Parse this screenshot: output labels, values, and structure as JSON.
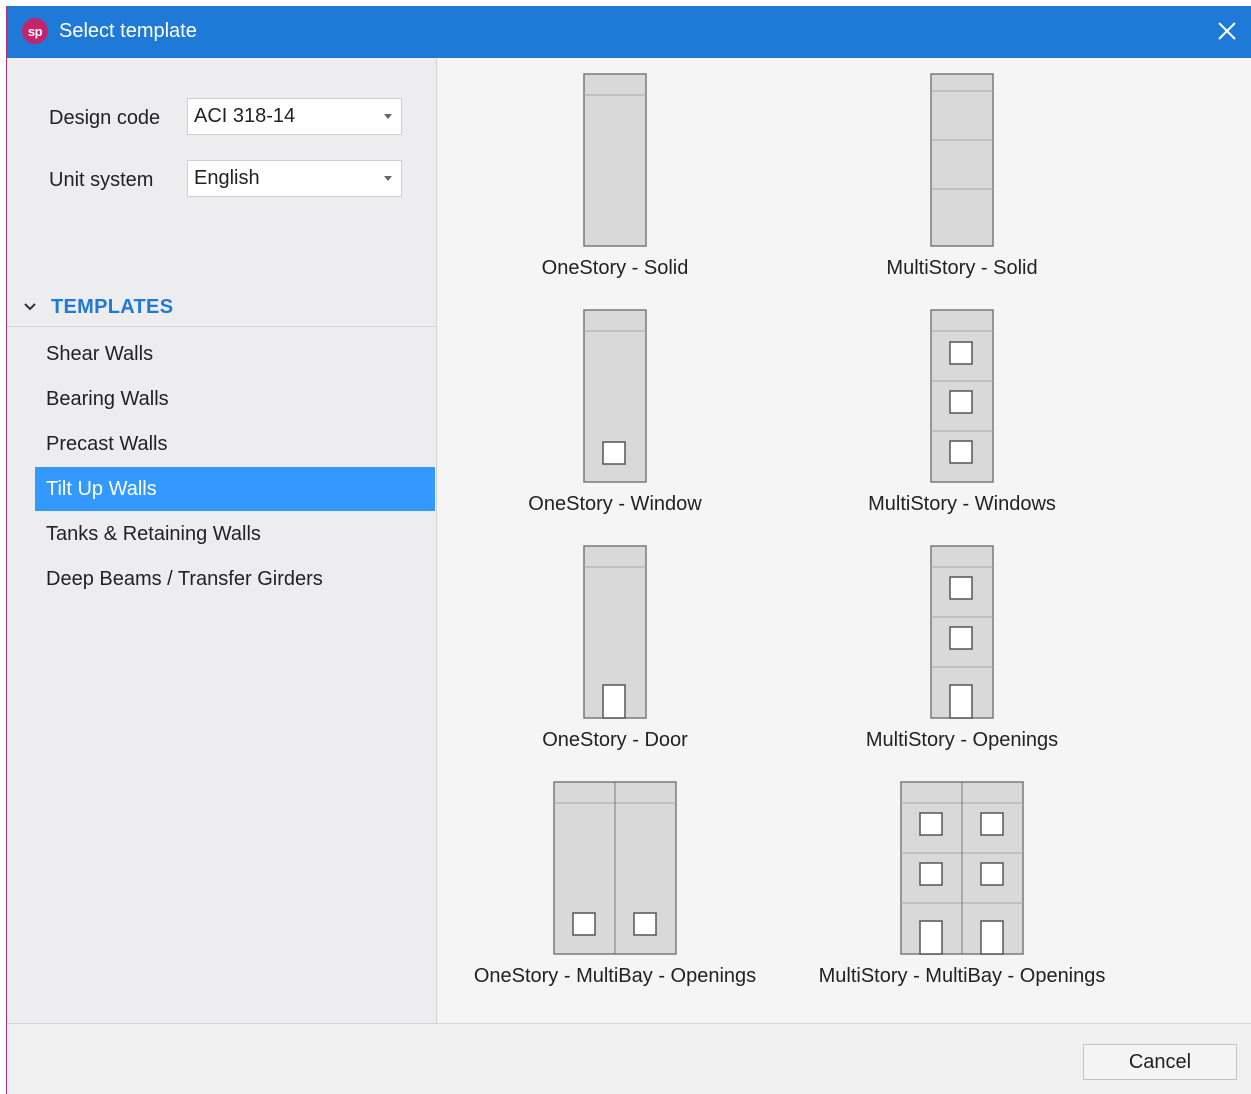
{
  "window": {
    "title": "Select template",
    "app_icon_text": "sp",
    "accent_color": "#1e7ad6",
    "selection_color": "#3399ff"
  },
  "settings": {
    "design_code_label": "Design code",
    "design_code_value": "ACI 318-14",
    "unit_system_label": "Unit system",
    "unit_system_value": "English"
  },
  "templates": {
    "header": "TEMPLATES",
    "categories": [
      {
        "label": "Shear Walls",
        "selected": false
      },
      {
        "label": "Bearing Walls",
        "selected": false
      },
      {
        "label": "Precast Walls",
        "selected": false
      },
      {
        "label": "Tilt Up Walls",
        "selected": true
      },
      {
        "label": "Tanks & Retaining Walls",
        "selected": false
      },
      {
        "label": "Deep Beams / Transfer Girders",
        "selected": false
      }
    ],
    "tiles": [
      {
        "label": "OneStory - Solid",
        "icon": "onestory-solid-icon"
      },
      {
        "label": "MultiStory - Solid",
        "icon": "multistory-solid-icon"
      },
      {
        "label": "OneStory - Window",
        "icon": "onestory-window-icon"
      },
      {
        "label": "MultiStory - Windows",
        "icon": "multistory-windows-icon"
      },
      {
        "label": "OneStory - Door",
        "icon": "onestory-door-icon"
      },
      {
        "label": "MultiStory - Openings",
        "icon": "multistory-openings-icon"
      },
      {
        "label": "OneStory - MultiBay - Openings",
        "icon": "onestory-multibay-openings-icon"
      },
      {
        "label": "MultiStory - MultiBay - Openings",
        "icon": "multistory-multibay-openings-icon"
      }
    ]
  },
  "footer": {
    "cancel_label": "Cancel"
  }
}
